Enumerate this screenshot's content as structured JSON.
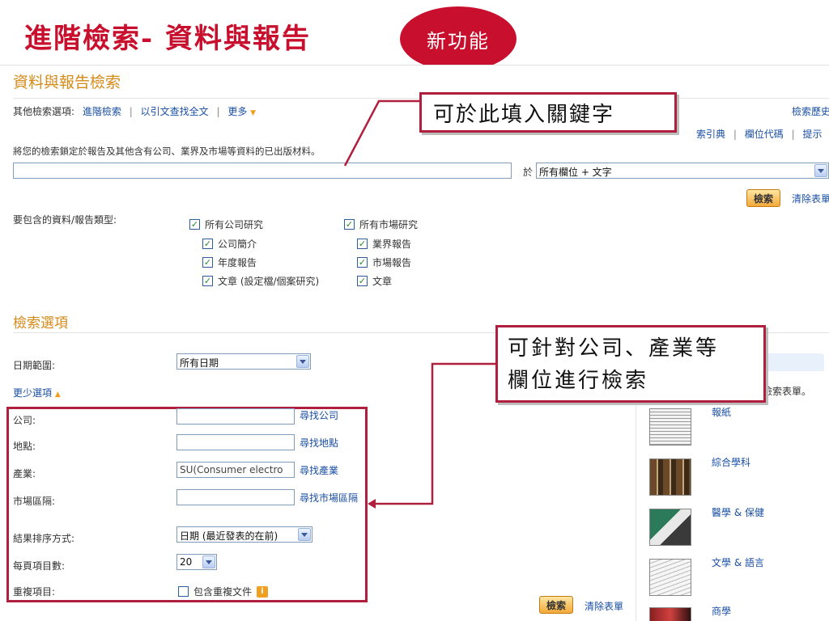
{
  "slide": {
    "title": "進階檢索- 資料與報告",
    "badge": "新功能"
  },
  "page": {
    "heading": "資料與報告檢索",
    "other_options_label": "其他檢索選項:",
    "links": [
      "進階檢索",
      "以引文查找全文",
      "更多"
    ],
    "right_links": {
      "search_history": "檢索歷史",
      "index": "索引典",
      "field_codes": "欄位代碼",
      "tips": "提示"
    },
    "description": "將您的檢索鎖定於報告及其他含有公司、業界及市場等資料的已出版材料。",
    "query_input": {
      "value": "",
      "placeholder": ""
    },
    "in_label": "於",
    "field_select": "所有欄位 + 文字",
    "search_button": "檢索",
    "clear_link": "清除表單"
  },
  "types": {
    "label": "要包含的資料/報告類型:",
    "company_group": {
      "label": "所有公司研究",
      "items": [
        "公司簡介",
        "年度報告",
        "文章 (設定檔/個案研究)"
      ]
    },
    "market_group": {
      "label": "所有市場研究",
      "items": [
        "業界報告",
        "市場報告",
        "文章"
      ]
    }
  },
  "search_options": {
    "heading": "檢索選項",
    "date_label": "日期範圍:",
    "date_value": "所有日期",
    "fewer_options": "更少選項",
    "company_label": "公司:",
    "company_link": "尋找公司",
    "company_value": "",
    "location_label": "地點:",
    "location_link": "尋找地點",
    "location_value": "",
    "industry_label": "產業:",
    "industry_link": "尋找產業",
    "industry_value": "SU(Consumer electro",
    "market_label": "市場區隔:",
    "market_link": "尋找市場區隔",
    "market_value": "",
    "sort_label": "結果排序方式:",
    "sort_value": "日期 (最近發表的在前)",
    "per_page_label": "每頁項目數:",
    "per_page_value": "20",
    "dup_label": "重複項目:",
    "dup_checkbox": "包含重複文件",
    "bottom_search": "檢索",
    "bottom_clear": "清除表單"
  },
  "sidebar": {
    "partial_text": "檢索表單。",
    "categories": [
      "報紙",
      "綜合學科",
      "醫學 & 保健",
      "文學 & 語言",
      "商學"
    ]
  },
  "callouts": {
    "keyword": "可於此填入關鍵字",
    "field_search_line1": "可針對公司、產業等",
    "field_search_line2": "欄位進行檢索"
  },
  "colors": {
    "accent_red": "#c8102e",
    "heading_orange": "#d68a18",
    "link_blue": "#1a4fa3"
  }
}
